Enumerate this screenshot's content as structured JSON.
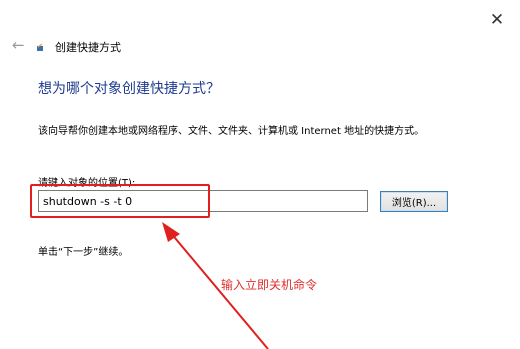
{
  "dialog": {
    "title": "创建快捷方式",
    "heading": "想为哪个对象创建快捷方式？",
    "description": "该向导帮你创建本地或网络程序、文件、文件夹、计算机或 Internet 地址的快捷方式。",
    "location_label": "请键入对象的位置(T):",
    "location_value": "shutdown -s -t 0",
    "browse_label": "浏览(R)...",
    "hint": "单击“下一步”继续。",
    "close_glyph": "✕",
    "back_glyph": "←"
  },
  "annotation": {
    "text": "输入立即关机命令",
    "color": "#e03030"
  },
  "colors": {
    "heading": "#1f3d8f",
    "highlight": "#e02020"
  }
}
